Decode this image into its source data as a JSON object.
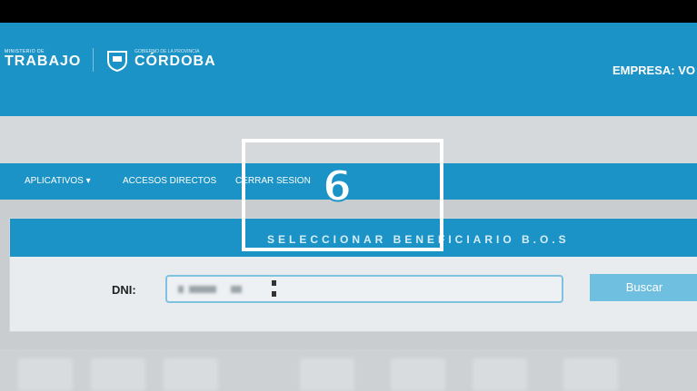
{
  "header": {
    "ministerio_small": "MINISTERIO DE",
    "ministerio_big": "TRABAJO",
    "gobierno_small": "GOBIERNO DE LA PROVINCIA",
    "cordoba": "CÓRDOBA",
    "empresa": "EMPRESA: VO"
  },
  "nav": {
    "aplicativos": "APLICATIVOS ▾",
    "accesos": "ACCESOS DIRECTOS",
    "cerrar": "CERRAR SESION"
  },
  "panel": {
    "title": "SELECCIONAR BENEFICIARIO B.O.S",
    "dni_label": "DNI:",
    "buscar": "Buscar"
  },
  "overlay": {
    "number": "6"
  },
  "colors": {
    "primary": "#1b93c6",
    "button": "#6ebfe0"
  }
}
